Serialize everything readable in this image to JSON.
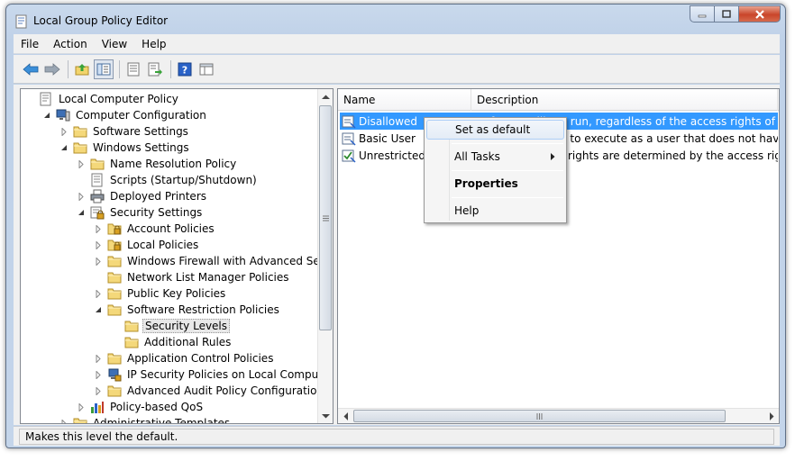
{
  "window": {
    "title": "Local Group Policy Editor"
  },
  "menubar": {
    "items": [
      "File",
      "Action",
      "View",
      "Help"
    ]
  },
  "toolbar": {
    "buttons": [
      "back-icon",
      "forward-icon",
      "up-folder-icon",
      "show-hide-tree-icon",
      "properties-icon",
      "export-list-icon",
      "help-icon",
      "console-view-icon"
    ]
  },
  "tree": {
    "items": [
      {
        "label": "Local Computer Policy",
        "icon": "computer-policy-icon"
      },
      {
        "label": "Computer Configuration",
        "icon": "computer-icon"
      },
      {
        "label": "Software Settings",
        "icon": "folder-icon"
      },
      {
        "label": "Windows Settings",
        "icon": "folder-icon"
      },
      {
        "label": "Name Resolution Policy",
        "icon": "folder-icon"
      },
      {
        "label": "Scripts (Startup/Shutdown)",
        "icon": "scripts-icon"
      },
      {
        "label": "Deployed Printers",
        "icon": "printer-icon"
      },
      {
        "label": "Security Settings",
        "icon": "security-settings-icon"
      },
      {
        "label": "Account Policies",
        "icon": "locked-folder-icon"
      },
      {
        "label": "Local Policies",
        "icon": "locked-folder-icon"
      },
      {
        "label": "Windows Firewall with Advanced Security",
        "icon": "folder-icon"
      },
      {
        "label": "Network List Manager Policies",
        "icon": "folder-icon"
      },
      {
        "label": "Public Key Policies",
        "icon": "folder-icon"
      },
      {
        "label": "Software Restriction Policies",
        "icon": "folder-icon"
      },
      {
        "label": "Security Levels",
        "icon": "folder-icon"
      },
      {
        "label": "Additional Rules",
        "icon": "folder-icon"
      },
      {
        "label": "Application Control Policies",
        "icon": "folder-icon"
      },
      {
        "label": "IP Security Policies on Local Computer",
        "icon": "ip-security-icon"
      },
      {
        "label": "Advanced Audit Policy Configuration",
        "icon": "folder-icon"
      },
      {
        "label": "Policy-based QoS",
        "icon": "qos-chart-icon"
      },
      {
        "label": "Administrative Templates",
        "icon": "folder-icon"
      }
    ]
  },
  "list": {
    "columns": [
      "Name",
      "Description"
    ],
    "rows": [
      {
        "name": "Disallowed",
        "description": "Software will not run, regardless of the access rights of the user."
      },
      {
        "name": "Basic User",
        "description": "Allows programs to execute as a user that does not have Administrator access rights"
      },
      {
        "name": "Unrestricted",
        "description": "Software access rights are determined by the access rights of the user."
      }
    ]
  },
  "context_menu": {
    "items": [
      "Set as default",
      "All Tasks",
      "Properties",
      "Help"
    ]
  },
  "statusbar": {
    "text": "Makes this level the default."
  }
}
